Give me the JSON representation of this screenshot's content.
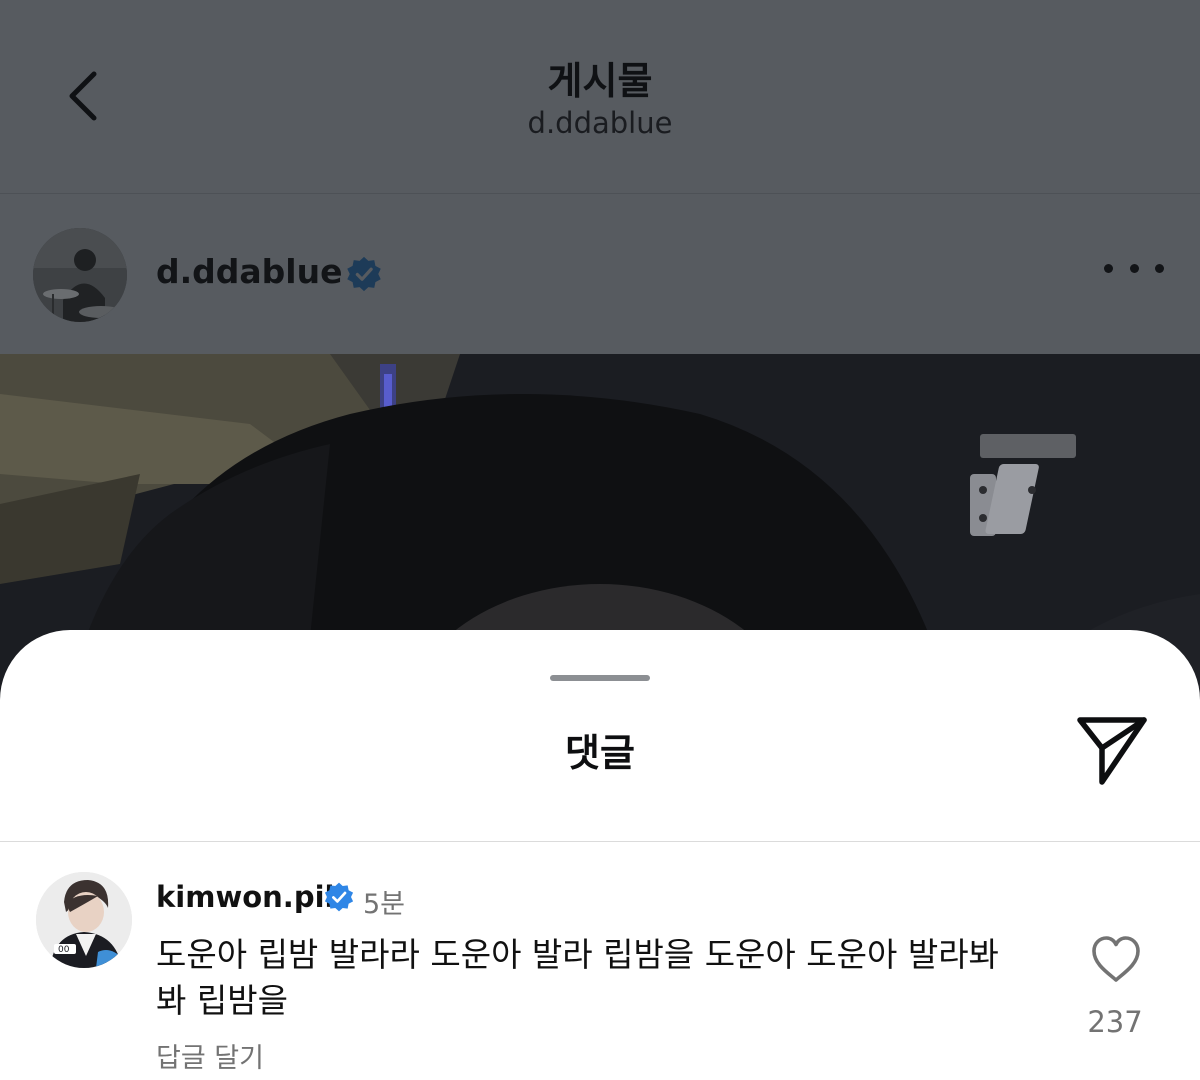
{
  "header": {
    "back_icon": "chevron-left-icon",
    "title": "게시물",
    "subtitle": "d.ddablue"
  },
  "post": {
    "author": "d.ddablue",
    "verified_icon": "verified-badge-icon",
    "more_icon": "more-horizontal-icon"
  },
  "comments_sheet": {
    "title": "댓글",
    "share_icon": "send-icon",
    "comments": [
      {
        "username": "kimwon.pil",
        "verified_icon": "verified-badge-icon",
        "time": "5분",
        "text": "도운아 립밤 발라라 도운아 발라 립밤을 도운아 도운아 발라봐 봐 립밤을",
        "reply_label": "답글 달기",
        "like_icon": "heart-outline-icon",
        "like_count": "237"
      }
    ]
  },
  "colors": {
    "overlay": "#575b60",
    "verified_blue": "#0095f6",
    "muted_text": "#737373"
  }
}
